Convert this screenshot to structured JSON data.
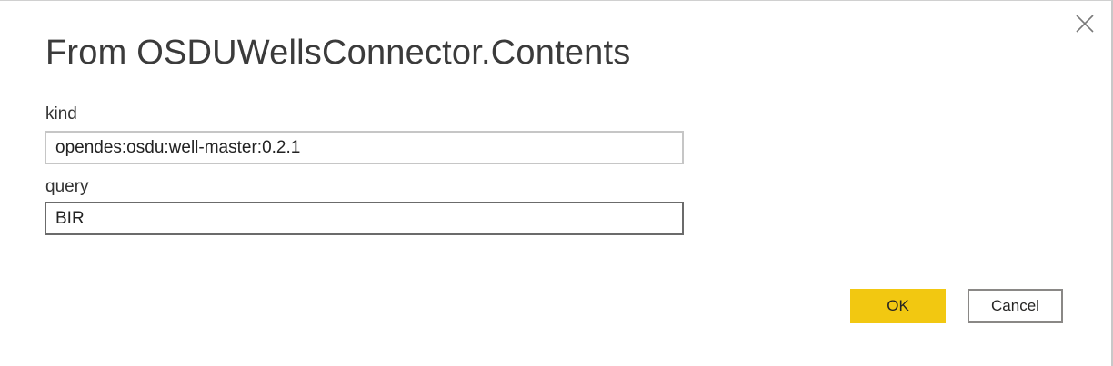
{
  "dialog": {
    "title": "From OSDUWellsConnector.Contents",
    "close_icon": "close-icon"
  },
  "fields": {
    "kind": {
      "label": "kind",
      "value": "opendes:osdu:well-master:0.2.1"
    },
    "query": {
      "label": "query",
      "value": "BIR"
    }
  },
  "buttons": {
    "ok_label": "OK",
    "cancel_label": "Cancel"
  },
  "colors": {
    "ok_button_bg": "#f2c811",
    "title_text": "#3b3b3b",
    "focused_border": "#6b6b6b"
  }
}
